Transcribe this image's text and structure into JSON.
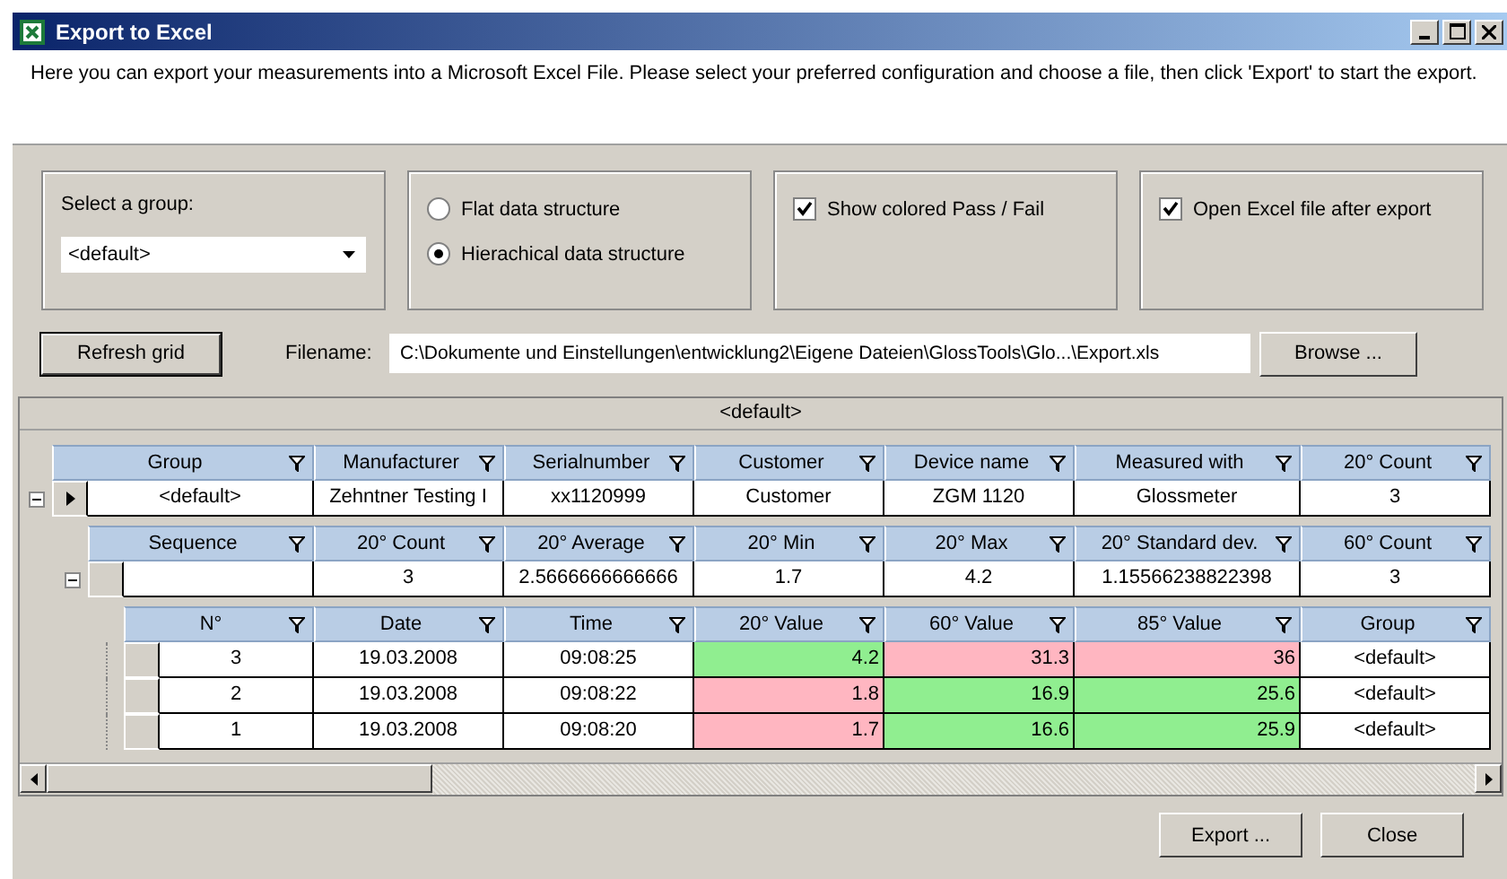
{
  "window": {
    "title": "Export to Excel"
  },
  "description": "Here you can export your measurements into a Microsoft Excel File. Please select your preferred configuration and choose a file, then click 'Export' to start the export.",
  "group_select": {
    "label": "Select a group:",
    "value": "<default>"
  },
  "structure_options": [
    {
      "label": "Flat data structure",
      "selected": false
    },
    {
      "label": "Hierachical data structure",
      "selected": true
    }
  ],
  "show_colored": {
    "label": "Show colored Pass / Fail",
    "checked": true
  },
  "open_after_export": {
    "label": "Open Excel file after export",
    "checked": true
  },
  "refresh_button": "Refresh grid",
  "filename": {
    "label": "Filename:",
    "value": "C:\\Dokumente und Einstellungen\\entwicklung2\\Eigene Dateien\\GlossTools\\Glo...\\Export.xls"
  },
  "browse_button": "Browse ...",
  "grid": {
    "caption": "<default>",
    "band": {
      "columns": [
        "Group",
        "Manufacturer",
        "Serialnumber",
        "Customer",
        "Device name",
        "Measured with",
        "20° Count"
      ],
      "rows": [
        {
          "current": true,
          "expanded": true,
          "cells": [
            {
              "text": "<default>"
            },
            {
              "text": "Zehntner Testing I"
            },
            {
              "text": "xx1120999"
            },
            {
              "text": "Customer"
            },
            {
              "text": "ZGM 1120"
            },
            {
              "text": "Glossmeter"
            },
            {
              "text": "3"
            }
          ],
          "child_band": {
            "columns": [
              "Sequence",
              "20° Count",
              "20° Average",
              "20° Min",
              "20° Max",
              "20° Standard dev.",
              "60° Count"
            ],
            "rows": [
              {
                "current": false,
                "expanded": true,
                "cells": [
                  {
                    "text": ""
                  },
                  {
                    "text": "3"
                  },
                  {
                    "text": "2.5666666666666"
                  },
                  {
                    "text": "1.7"
                  },
                  {
                    "text": "4.2"
                  },
                  {
                    "text": "1.15566238822398"
                  },
                  {
                    "text": "3"
                  }
                ],
                "child_band": {
                  "columns": [
                    "N°",
                    "Date",
                    "Time",
                    "20° Value",
                    "60° Value",
                    "85° Value",
                    "Group"
                  ],
                  "rows": [
                    {
                      "current": false,
                      "cells": [
                        {
                          "text": "3"
                        },
                        {
                          "text": "19.03.2008"
                        },
                        {
                          "text": "09:08:25"
                        },
                        {
                          "text": "4.2",
                          "color": "#90ee90"
                        },
                        {
                          "text": "31.3",
                          "color": "#ffb6c1"
                        },
                        {
                          "text": "36",
                          "color": "#ffb6c1"
                        },
                        {
                          "text": "<default>"
                        }
                      ]
                    },
                    {
                      "current": false,
                      "cells": [
                        {
                          "text": "2"
                        },
                        {
                          "text": "19.03.2008"
                        },
                        {
                          "text": "09:08:22"
                        },
                        {
                          "text": "1.8",
                          "color": "#ffb6c1"
                        },
                        {
                          "text": "16.9",
                          "color": "#90ee90"
                        },
                        {
                          "text": "25.6",
                          "color": "#90ee90"
                        },
                        {
                          "text": "<default>"
                        }
                      ]
                    },
                    {
                      "current": false,
                      "cells": [
                        {
                          "text": "1"
                        },
                        {
                          "text": "19.03.2008"
                        },
                        {
                          "text": "09:08:20"
                        },
                        {
                          "text": "1.7",
                          "color": "#ffb6c1"
                        },
                        {
                          "text": "16.6",
                          "color": "#90ee90"
                        },
                        {
                          "text": "25.9",
                          "color": "#90ee90"
                        },
                        {
                          "text": "<default>"
                        }
                      ]
                    }
                  ]
                }
              }
            ]
          }
        }
      ]
    }
  },
  "buttons": [
    "Export ...",
    "Close"
  ]
}
